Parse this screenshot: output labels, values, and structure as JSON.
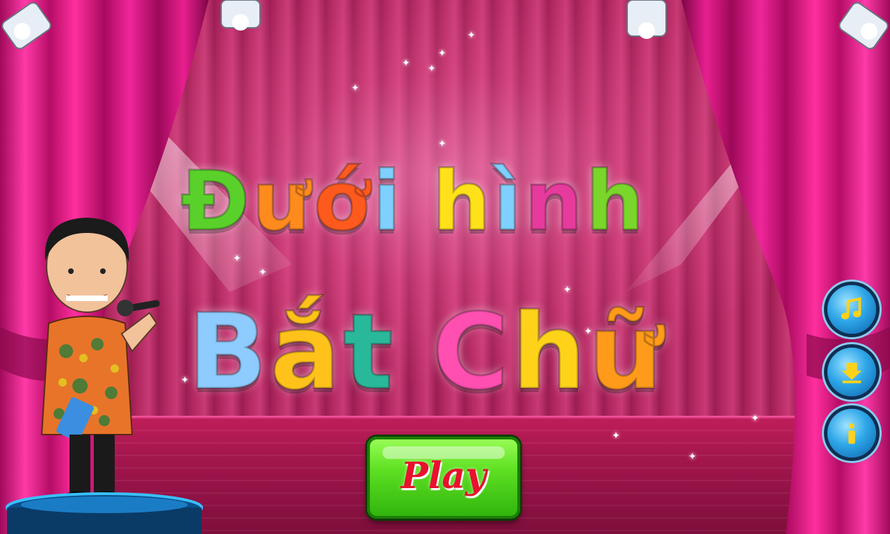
{
  "game": {
    "title_line1": [
      "Đ",
      "ư",
      "ớ",
      "i",
      " ",
      "h",
      "ì",
      "n",
      "h"
    ],
    "title_line2": [
      "B",
      "ắ",
      "t",
      " ",
      "C",
      "h",
      "ữ"
    ],
    "letter_colors_line1": [
      "#5ad12a",
      "#ff8a1e",
      "#ff5a1e",
      "#7fd0ff",
      "#ffffff",
      "#ffe11a",
      "#7fd0ff",
      "#e63a9c",
      "#7ad62a"
    ],
    "letter_colors_line2": [
      "#8ecbff",
      "#ffc21a",
      "#29b89a",
      "#ffffff",
      "#ff4fb0",
      "#ffd21a",
      "#ff9a1a"
    ],
    "play_label": "Play"
  },
  "side_buttons": [
    {
      "name": "music",
      "icon": "music-note-icon"
    },
    {
      "name": "download",
      "icon": "download-icon"
    },
    {
      "name": "info",
      "icon": "info-icon"
    }
  ],
  "colors": {
    "curtain": "#d4107a",
    "stage_floor": "#a3164d",
    "play_button": "#5ee022",
    "play_text": "#e8112e",
    "side_button": "#2ea6e8"
  }
}
